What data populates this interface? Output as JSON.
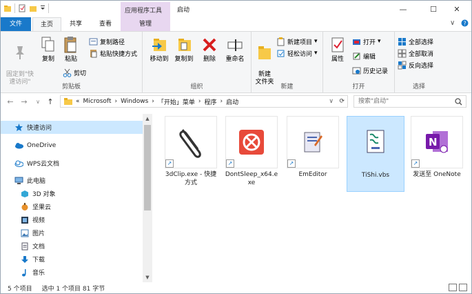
{
  "window": {
    "title": "启动",
    "context_group": "应用程序工具"
  },
  "controls": {
    "minimize": "—",
    "maximize": "☐",
    "close": "✕"
  },
  "tabs": [
    {
      "label": "文件"
    },
    {
      "label": "主页"
    },
    {
      "label": "共享"
    },
    {
      "label": "查看"
    },
    {
      "label": "管理"
    }
  ],
  "ribbon": {
    "pin": "固定到\"快\n速访问\"",
    "copy": "复制",
    "paste": "粘贴",
    "copy_path": "复制路径",
    "paste_shortcut": "粘贴快捷方式",
    "cut": "剪切",
    "clipboard_group": "剪贴板",
    "move_to": "移动到",
    "copy_to": "复制到",
    "delete": "删除",
    "rename": "重命名",
    "organize_group": "组织",
    "new_folder": "新建\n文件夹",
    "new_item": "新建项目",
    "easy_access": "轻松访问",
    "new_group": "新建",
    "properties": "属性",
    "open": "打开",
    "edit": "编辑",
    "history": "历史记录",
    "open_group": "打开",
    "select_all": "全部选择",
    "select_none": "全部取消",
    "invert_selection": "反向选择",
    "select_group": "选择"
  },
  "address": {
    "prefix": "«",
    "crumbs": [
      "Microsoft",
      "Windows",
      "「开始」菜单",
      "程序",
      "启动"
    ]
  },
  "search": {
    "placeholder": "搜索\"启动\""
  },
  "nav": {
    "items": [
      {
        "label": "快速访问",
        "icon": "star-icon"
      },
      {
        "label": "OneDrive",
        "icon": "cloud-icon"
      },
      {
        "label": "WPS云文档",
        "icon": "cloud-icon"
      },
      {
        "label": "此电脑",
        "icon": "computer-icon"
      },
      {
        "label": "3D 对象",
        "icon": "cube-icon"
      },
      {
        "label": "坚果云",
        "icon": "nut-icon"
      },
      {
        "label": "视频",
        "icon": "video-icon"
      },
      {
        "label": "图片",
        "icon": "picture-icon"
      },
      {
        "label": "文档",
        "icon": "document-icon"
      },
      {
        "label": "下载",
        "icon": "download-icon"
      },
      {
        "label": "音乐",
        "icon": "music-icon"
      }
    ]
  },
  "files": [
    {
      "name": "3dClip.exe - 快捷方式",
      "icon": "paperclip-icon"
    },
    {
      "name": "DontSleep_x64.exe",
      "icon": "stop-icon"
    },
    {
      "name": "EmEditor",
      "icon": "editor-icon"
    },
    {
      "name": "TiShi.vbs",
      "icon": "script-icon"
    },
    {
      "name": "发送至 OneNote",
      "icon": "onenote-icon"
    }
  ],
  "status": {
    "count": "5 个项目",
    "selection": "选中 1 个项目  81 字节"
  },
  "colors": {
    "accent": "#1979ca",
    "selection": "#cce8ff",
    "context": "#e8d7f0"
  }
}
